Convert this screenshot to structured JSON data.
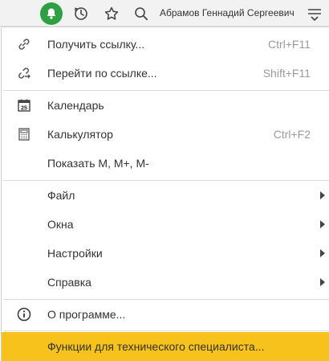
{
  "topbar": {
    "user_name": "Абрамов Геннадий Сергеевич",
    "icons": [
      "bell-icon",
      "history-icon",
      "star-icon",
      "search-icon",
      "menu-icon"
    ],
    "bell_color": "#2f9f46"
  },
  "menu": {
    "items": [
      {
        "label": "Получить ссылку...",
        "shortcut": "Ctrl+F11",
        "icon": "link-icon"
      },
      {
        "label": "Перейти по ссылке...",
        "shortcut": "Shift+F11",
        "icon": "goto-link-icon"
      },
      {
        "label": "Календарь",
        "shortcut": "",
        "icon": "calendar-icon",
        "icon_text": "25"
      },
      {
        "label": "Калькулятор",
        "shortcut": "Ctrl+F2",
        "icon": "calculator-icon"
      },
      {
        "label": "Показать M, M+, M-",
        "shortcut": ""
      },
      {
        "label": "Файл",
        "submenu": true
      },
      {
        "label": "Окна",
        "submenu": true
      },
      {
        "label": "Настройки",
        "submenu": true
      },
      {
        "label": "Справка",
        "submenu": true
      },
      {
        "label": "О программе...",
        "icon": "info-icon"
      },
      {
        "label": "Функции для технического специалиста...",
        "highlighted": true
      }
    ],
    "highlight_color": "#f6c21b"
  }
}
